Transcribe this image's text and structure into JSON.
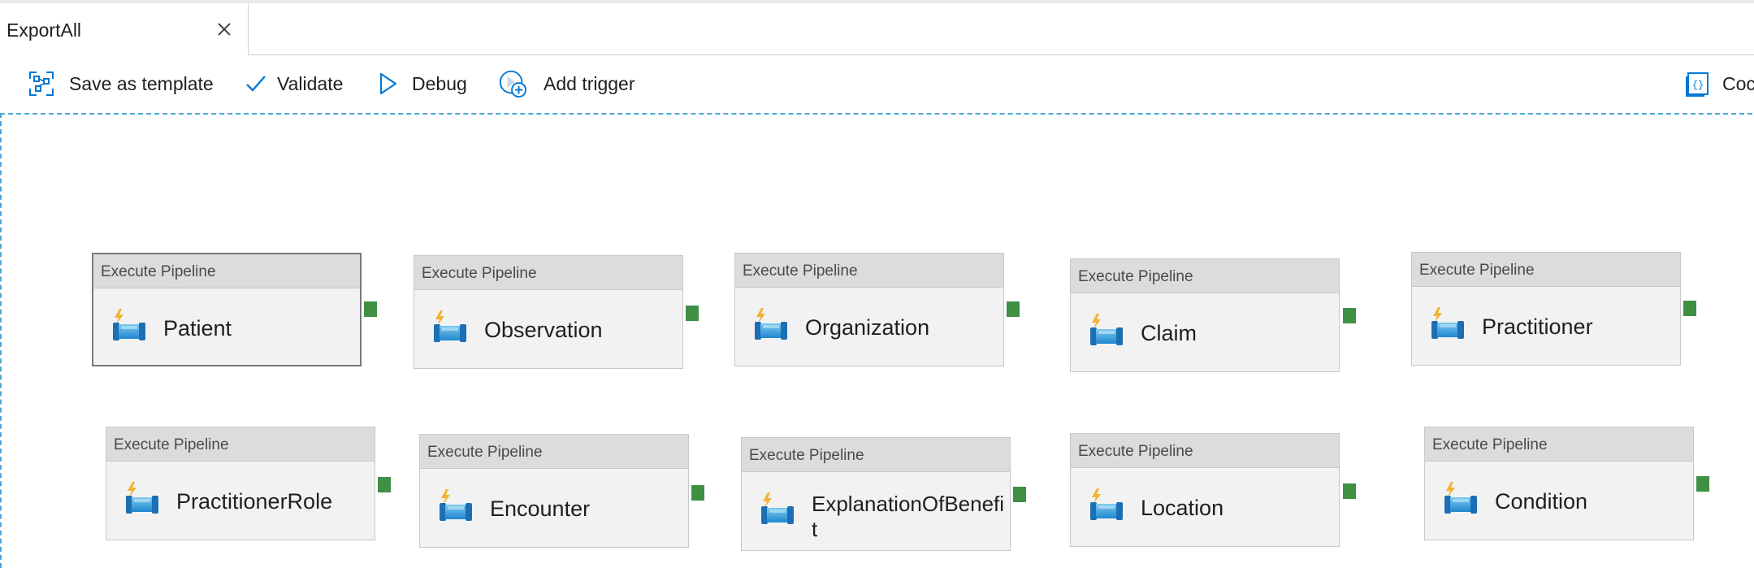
{
  "tab": {
    "title": "ExportAll",
    "close_icon": "close-icon"
  },
  "toolbar": {
    "save_template": "Save as template",
    "validate": "Validate",
    "debug": "Debug",
    "add_trigger": "Add trigger",
    "code": "Coc"
  },
  "activities": [
    {
      "type": "Execute Pipeline",
      "name": "Patient"
    },
    {
      "type": "Execute Pipeline",
      "name": "Observation"
    },
    {
      "type": "Execute Pipeline",
      "name": "Organization"
    },
    {
      "type": "Execute Pipeline",
      "name": "Claim"
    },
    {
      "type": "Execute Pipeline",
      "name": "Practitioner"
    },
    {
      "type": "Execute Pipeline",
      "name": "PractitionerRole"
    },
    {
      "type": "Execute Pipeline",
      "name": "Encounter"
    },
    {
      "type": "Execute Pipeline",
      "name": "ExplanationOfBenefit"
    },
    {
      "type": "Execute Pipeline",
      "name": "Location"
    },
    {
      "type": "Execute Pipeline",
      "name": "Condition"
    }
  ],
  "colors": {
    "accent": "#0078d4",
    "port": "#3f8f44",
    "canvas_border": "#4aa7d8"
  }
}
